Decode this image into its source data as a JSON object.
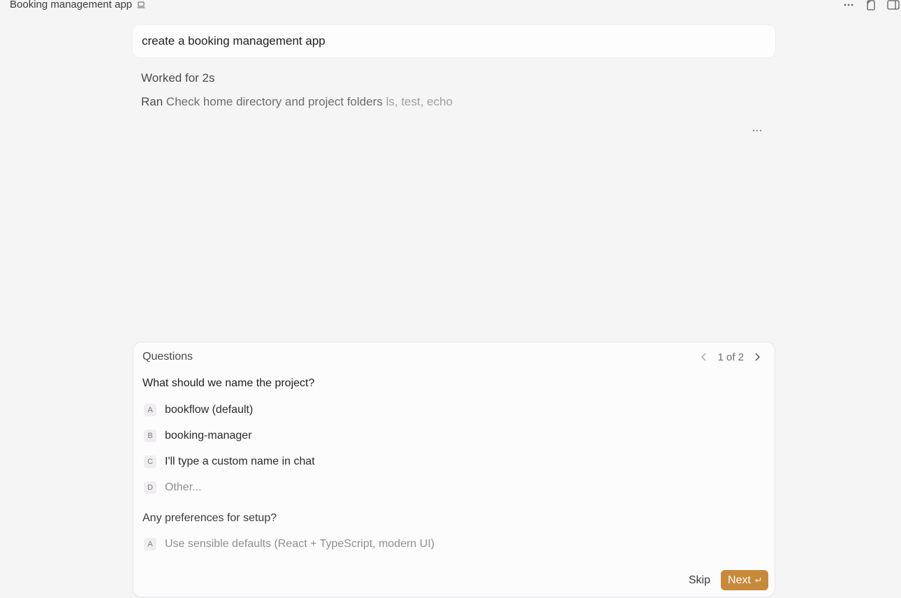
{
  "window": {
    "title": "Booking management app",
    "title_icon": "laptop-icon",
    "actions": [
      "more-icon",
      "copy-icon",
      "sidebar-toggle-icon"
    ]
  },
  "conversation": {
    "user_message": "create a booking management app",
    "worked_for": "Worked for 2s",
    "ran": {
      "label": "Ran",
      "description": "Check home directory and project folders",
      "commands": "ls, test, echo"
    },
    "message_more_icon": "ellipsis-icon"
  },
  "questions": {
    "header": "Questions",
    "pager": {
      "text": "1 of 2",
      "prev_icon": "chevron-left-icon",
      "next_icon": "chevron-right-icon"
    },
    "items": [
      {
        "title": "What should we name the project?",
        "options": [
          {
            "key": "A",
            "label": "bookflow (default)"
          },
          {
            "key": "B",
            "label": "booking-manager"
          },
          {
            "key": "C",
            "label": "I'll type a custom name in chat"
          },
          {
            "key": "D",
            "label": "Other..."
          }
        ]
      },
      {
        "title": "Any preferences for setup?",
        "options": [
          {
            "key": "A",
            "label": "Use sensible defaults (React + TypeScript, modern UI)"
          }
        ]
      }
    ],
    "skip_label": "Skip",
    "next_label": "Next",
    "next_icon": "enter-icon",
    "accent_color": "#c8893a"
  }
}
